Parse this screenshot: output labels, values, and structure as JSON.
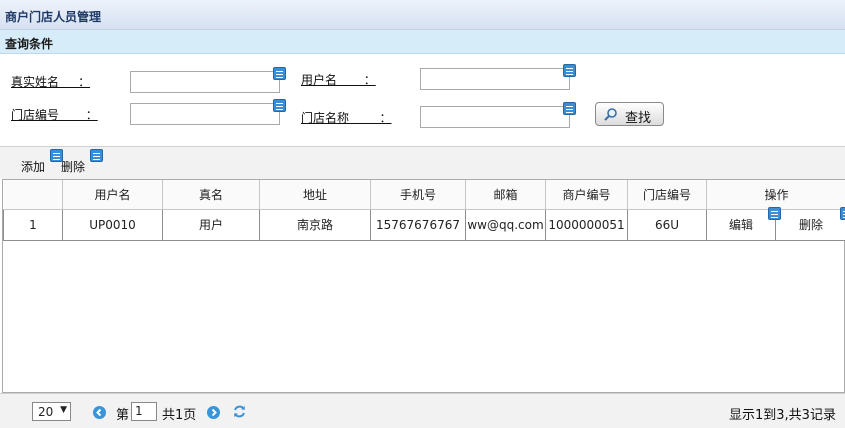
{
  "title": "商户门店人员管理",
  "query": {
    "header": "查询条件",
    "fields": [
      {
        "label": "真实姓名     ：",
        "value": ""
      },
      {
        "label": "用户名       ：",
        "value": ""
      },
      {
        "label": "门店编号       ：",
        "value": ""
      },
      {
        "label": "门店名称        ：",
        "value": ""
      }
    ],
    "search_label": "查找"
  },
  "toolbar": {
    "add_label": "添加",
    "delete_label": "删除"
  },
  "table": {
    "columns": [
      "",
      "用户名",
      "真名",
      "地址",
      "手机号",
      "邮箱",
      "商户编号",
      "门店编号",
      "操作"
    ],
    "rows": [
      {
        "index": "1",
        "username": "UP0010",
        "realname": "用户",
        "address": "南京路",
        "phone": "15767676767",
        "email": "ww@qq.com",
        "merchant_no": "1000000051",
        "store_no": "66U",
        "edit": "编辑",
        "delete": "删除"
      }
    ]
  },
  "pager": {
    "page_size": "20",
    "page_prefix": "第",
    "page_value": "1",
    "page_total": "共1页",
    "summary": "显示1到3,共3记录"
  },
  "colors": {
    "accent": "#3a8ed6",
    "title_bg": "#d5e0f1",
    "query_bg": "#d6ecf9"
  }
}
